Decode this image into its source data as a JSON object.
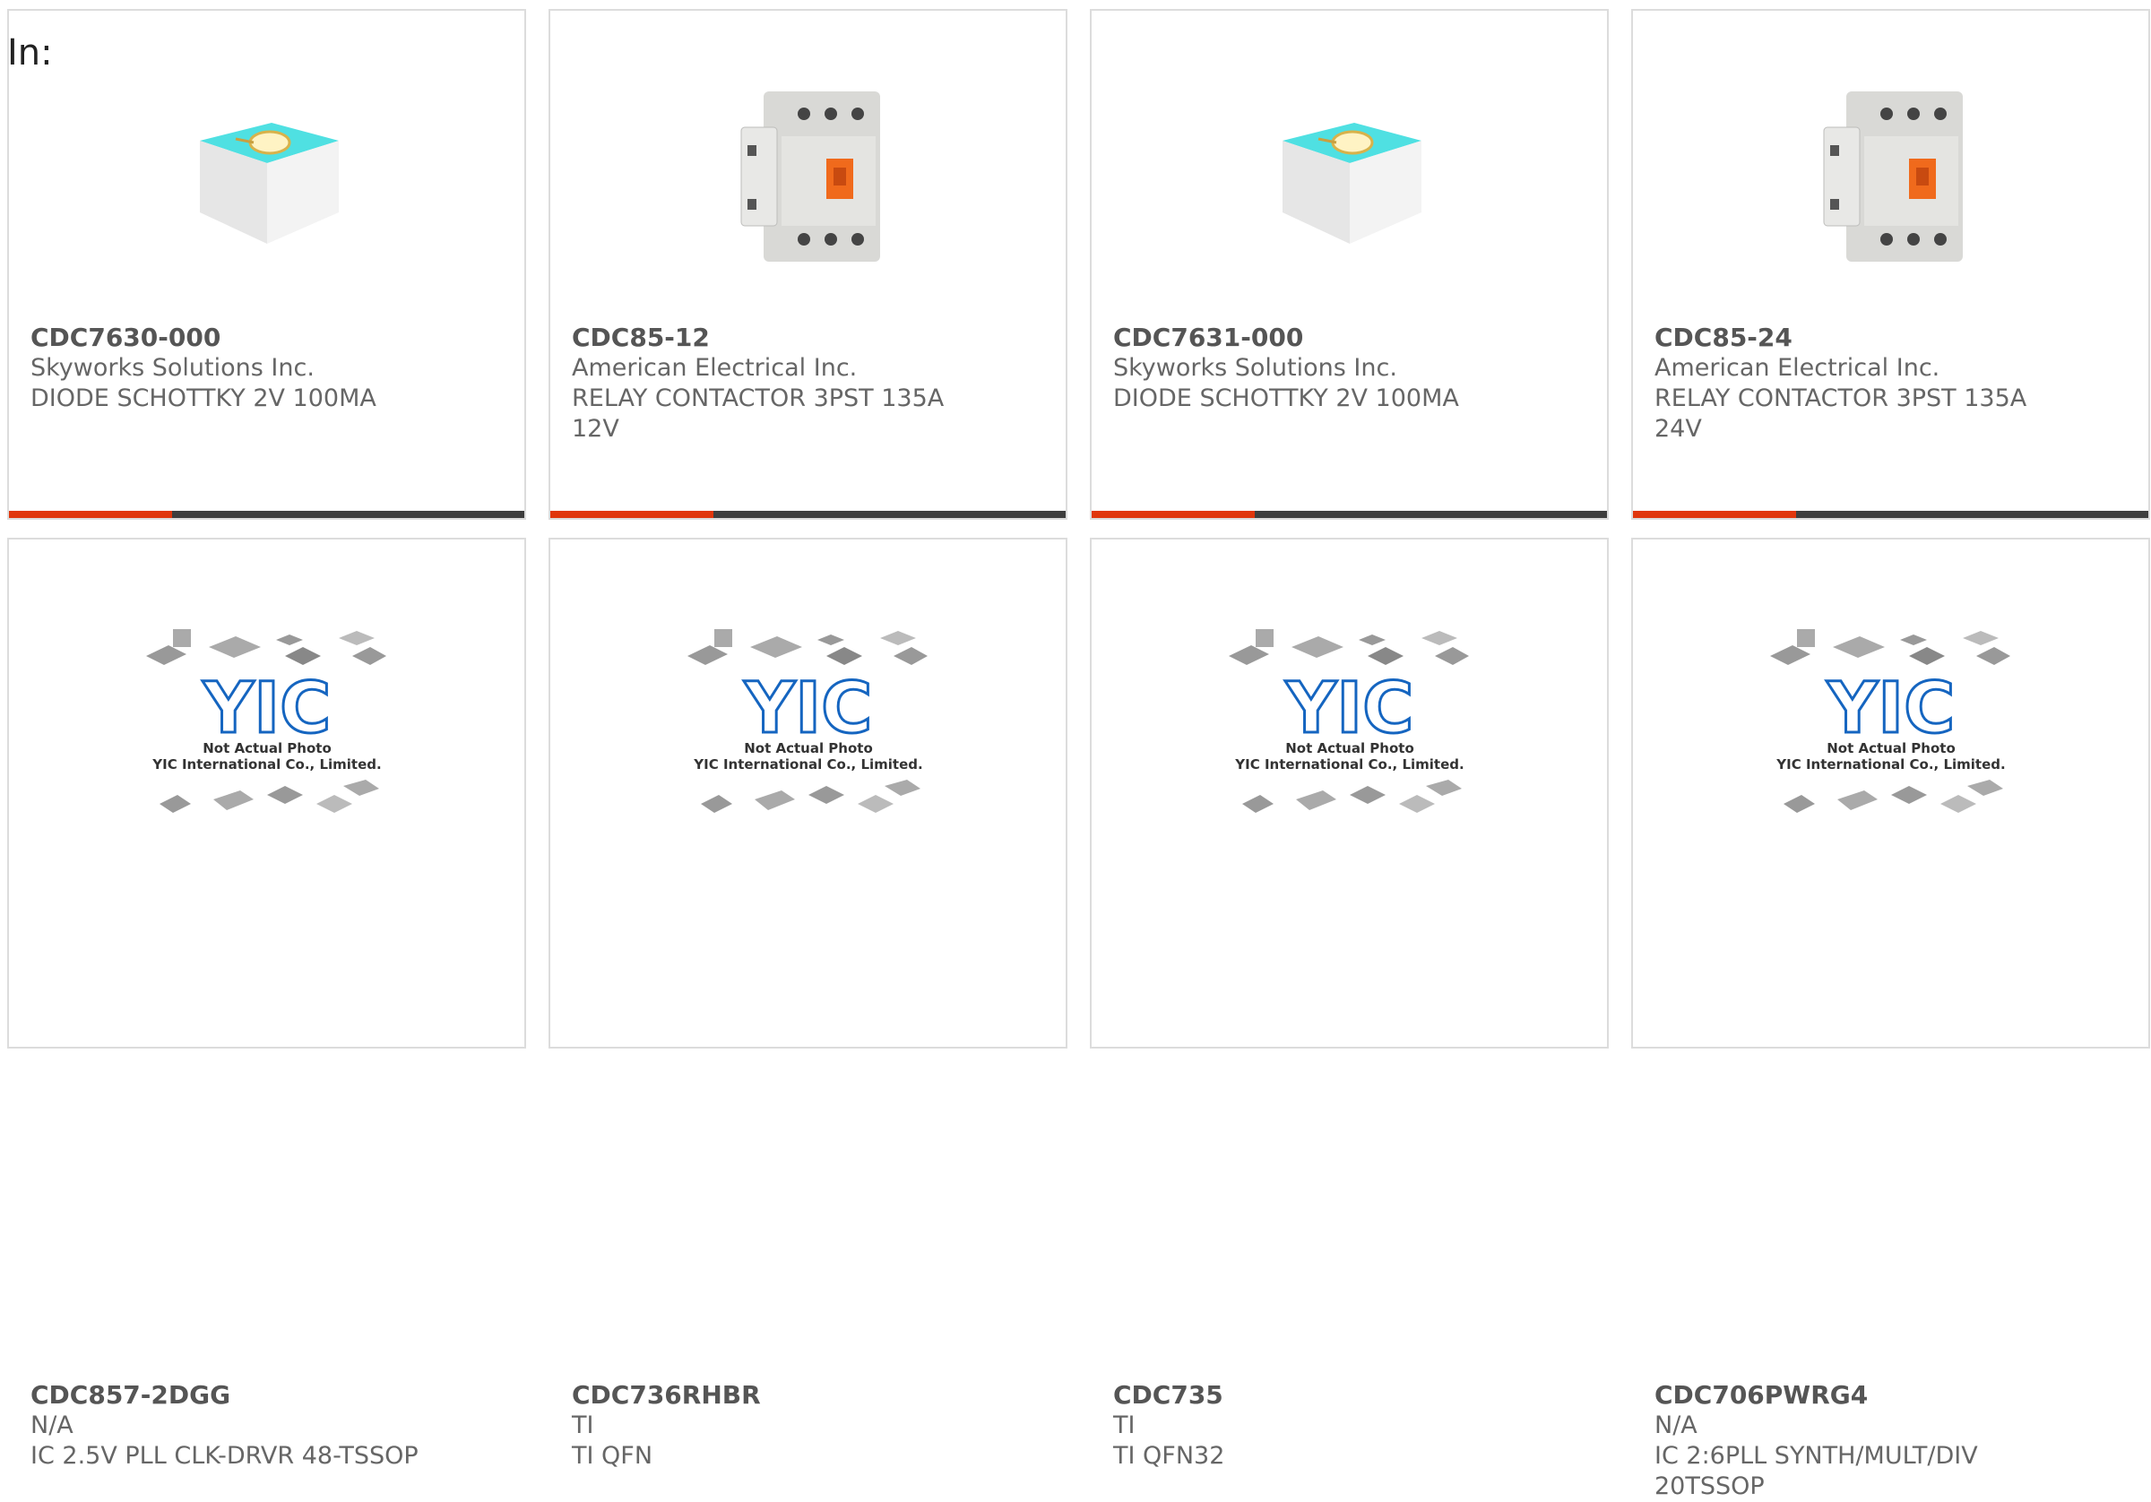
{
  "header": {
    "in_label": "In:"
  },
  "colors": {
    "accent": "#e0360c",
    "bar_dark": "#3e3e3e",
    "text_primary": "#555555",
    "text_secondary": "#666666"
  },
  "products": [
    {
      "part_number": "CDC7630-000",
      "manufacturer": "Skyworks Solutions Inc.",
      "description": "DIODE SCHOTTKY 2V 100MA",
      "image": "diode-cube-icon"
    },
    {
      "part_number": "CDC85-12",
      "manufacturer": "American Electrical Inc.",
      "description": "RELAY CONTACTOR 3PST 135A 12V",
      "image": "contactor-icon"
    },
    {
      "part_number": "CDC7631-000",
      "manufacturer": "Skyworks Solutions Inc.",
      "description": "DIODE SCHOTTKY 2V 100MA",
      "image": "diode-cube-icon"
    },
    {
      "part_number": "CDC85-24",
      "manufacturer": "American Electrical Inc.",
      "description": "RELAY CONTACTOR 3PST 135A 24V",
      "image": "contactor-icon"
    },
    {
      "part_number": "CDC857-2DGG",
      "manufacturer": "N/A",
      "description": "IC 2.5V PLL CLK-DRVR 48-TSSOP",
      "image": "yic-placeholder"
    },
    {
      "part_number": "CDC736RHBR",
      "manufacturer": "TI",
      "description": "TI QFN",
      "image": "yic-placeholder"
    },
    {
      "part_number": "CDC735",
      "manufacturer": "TI",
      "description": "TI QFN32",
      "image": "yic-placeholder"
    },
    {
      "part_number": "CDC706PWRG4",
      "manufacturer": "N/A",
      "description": "IC 2:6PLL SYNTH/MULT/DIV 20TSSOP",
      "image": "yic-placeholder"
    }
  ],
  "placeholder": {
    "line1": "Not Actual Photo",
    "line2": "YIC International Co., Limited.",
    "logo": "YIC"
  }
}
